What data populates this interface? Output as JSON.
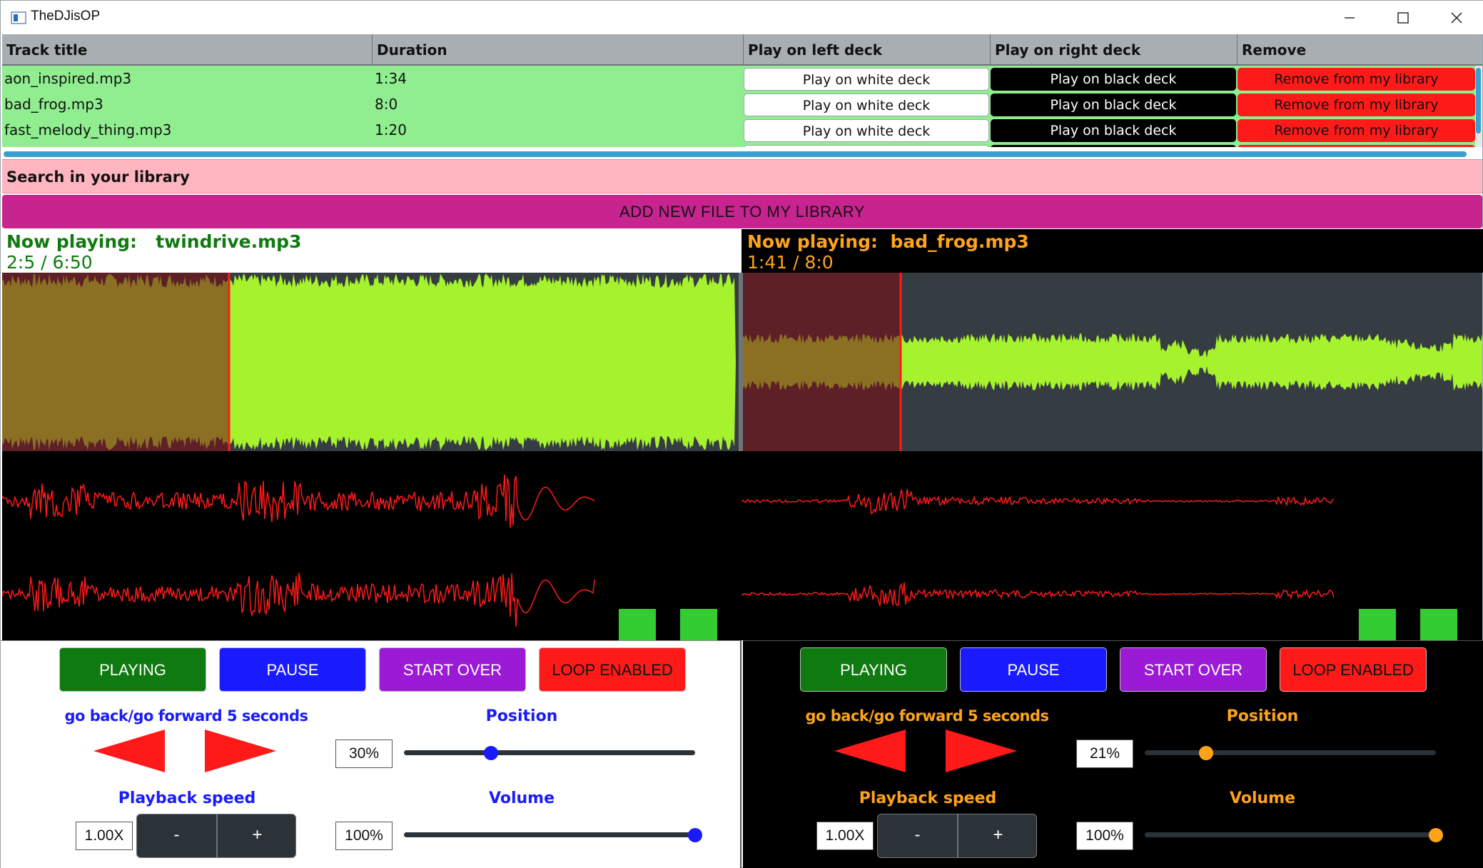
{
  "window": {
    "title": "TheDJisOP"
  },
  "library": {
    "columns": [
      "Track title",
      "Duration",
      "Play on left deck",
      "Play on right deck",
      "Remove"
    ],
    "rows": [
      {
        "title": "aon_inspired.mp3",
        "duration": "1:34",
        "left": "Play on white deck",
        "right": "Play on black deck",
        "remove": "Remove from my library"
      },
      {
        "title": "bad_frog.mp3",
        "duration": "8:0",
        "left": "Play on white deck",
        "right": "Play on black deck",
        "remove": "Remove from my library"
      },
      {
        "title": "fast_melody_thing.mp3",
        "duration": "1:20",
        "left": "Play on white deck",
        "right": "Play on black deck",
        "remove": "Remove from my library"
      }
    ]
  },
  "search": {
    "placeholder": "Search in your library"
  },
  "add_button": "ADD NEW FILE TO MY LIBRARY",
  "decks": [
    {
      "now_playing_label": "Now playing:",
      "track": "twindrive.mp3",
      "time": "2:5 / 6:50",
      "played_fraction": 0.308,
      "accent": "#0f7a0f",
      "buttons": {
        "play": "PLAYING",
        "pause": "PAUSE",
        "start_over": "START OVER",
        "loop": "LOOP ENABLED"
      },
      "skip_label": "go back/go forward 5 seconds",
      "position_label": "Position",
      "position_value": "30%",
      "position_fraction": 0.3,
      "speed_label": "Playback speed",
      "speed_value": "1.00X",
      "minus": "-",
      "plus": "+",
      "volume_label": "Volume",
      "volume_value": "100%",
      "volume_fraction": 1.0
    },
    {
      "now_playing_label": "Now playing:",
      "track": "bad_frog.mp3",
      "time": "1:41 / 8:0",
      "played_fraction": 0.213,
      "accent": "#ffa31a",
      "buttons": {
        "play": "PLAYING",
        "pause": "PAUSE",
        "start_over": "START OVER",
        "loop": "LOOP ENABLED"
      },
      "skip_label": "go back/go forward 5 seconds",
      "position_label": "Position",
      "position_value": "21%",
      "position_fraction": 0.21,
      "speed_label": "Playback speed",
      "speed_value": "1.00X",
      "minus": "-",
      "plus": "+",
      "volume_label": "Volume",
      "volume_value": "100%",
      "volume_fraction": 1.0
    }
  ],
  "colors": {
    "table_rows": "#90ee90",
    "search_bg": "#ffb6c1",
    "add_bg": "#c8248f",
    "waveform_unplayed": "#a6f22d",
    "waveform_played": "#8b7023",
    "playhead": "#ff1a1a",
    "oscilloscope": "#ff1a1a",
    "level_meter": "#33cc33",
    "btn_playing": "#0f7a0f",
    "btn_pause": "#1a1aff",
    "btn_start_over": "#9b1ad6",
    "btn_loop": "#ff1a1a"
  }
}
